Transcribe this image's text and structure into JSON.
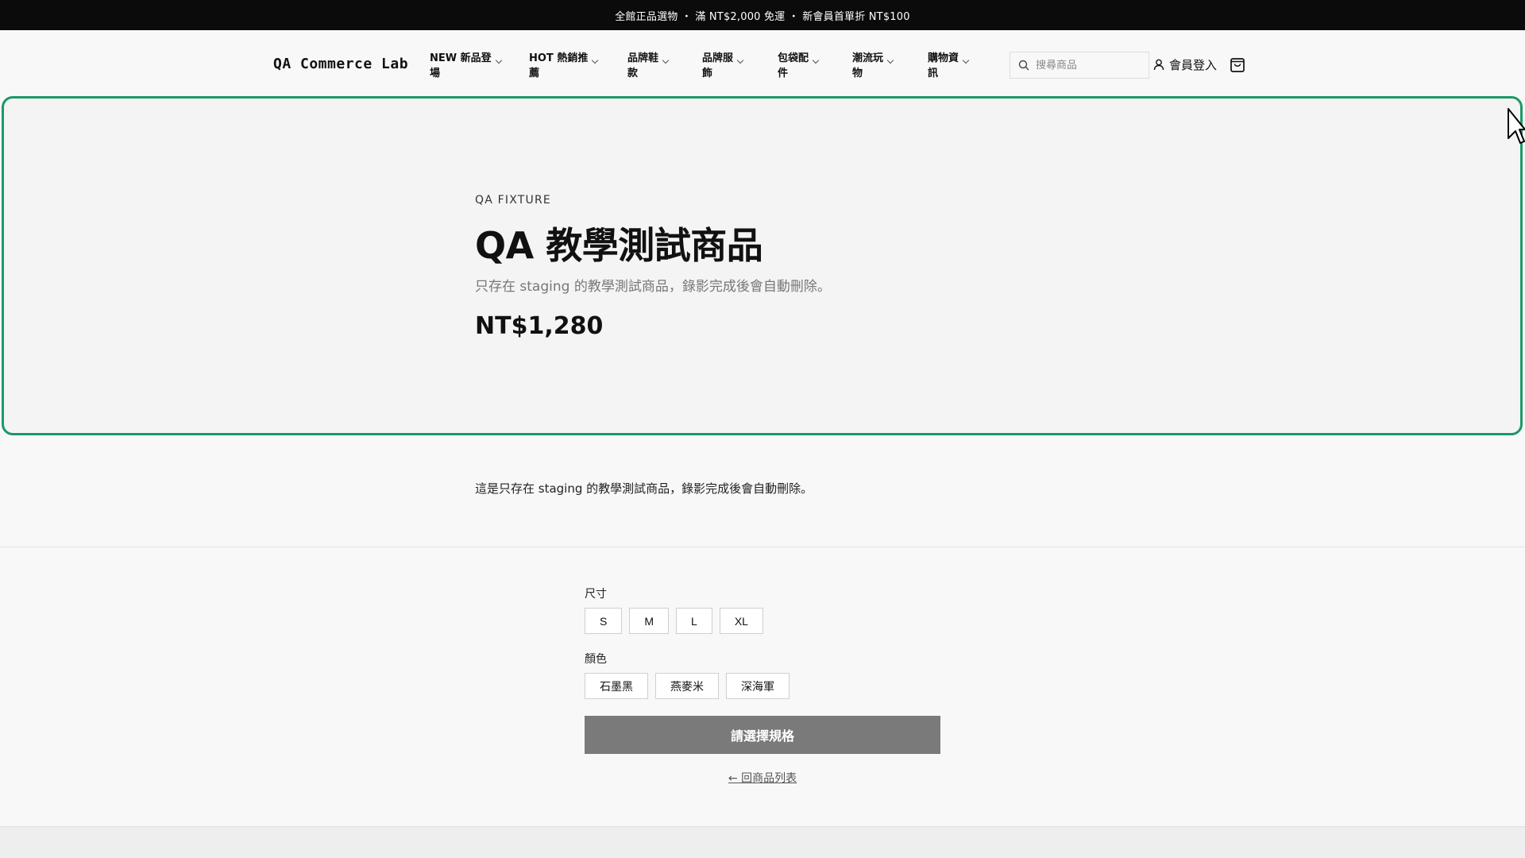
{
  "announcement": "全館正品選物 ・ 滿 NT$2,000 免運 ・ 新會員首單折 NT$100",
  "header": {
    "logo": "QA Commerce Lab",
    "nav": [
      {
        "line1": "NEW 新品登",
        "line2": "場"
      },
      {
        "line1": "HOT 熱銷推",
        "line2": "薦"
      },
      {
        "line1": "品牌鞋",
        "line2": "款"
      },
      {
        "line1": "品牌服",
        "line2": "飾"
      },
      {
        "line1": "包袋配",
        "line2": "件"
      },
      {
        "line1": "潮流玩",
        "line2": "物"
      },
      {
        "line1": "購物資",
        "line2": "訊"
      }
    ],
    "search_placeholder": "搜尋商品",
    "login_label": "會員登入"
  },
  "hero": {
    "eyebrow": "QA FIXTURE",
    "title": "QA 教學測試商品",
    "subtitle": "只存在 staging 的教學測試商品，錄影完成後會自動刪除。",
    "price": "NT$1,280"
  },
  "description": "這是只存在 staging 的教學測試商品，錄影完成後會自動刪除。",
  "options": {
    "size_label": "尺寸",
    "sizes": [
      "S",
      "M",
      "L",
      "XL"
    ],
    "color_label": "顏色",
    "colors": [
      "石墨黑",
      "燕麥米",
      "深海軍"
    ]
  },
  "cta_label": "請選擇規格",
  "back_link": "← 回商品列表",
  "colors": {
    "announcement_bg": "#0b0b0b",
    "highlight_border": "#1a9968",
    "cta_disabled_bg": "#7a7a7a"
  }
}
